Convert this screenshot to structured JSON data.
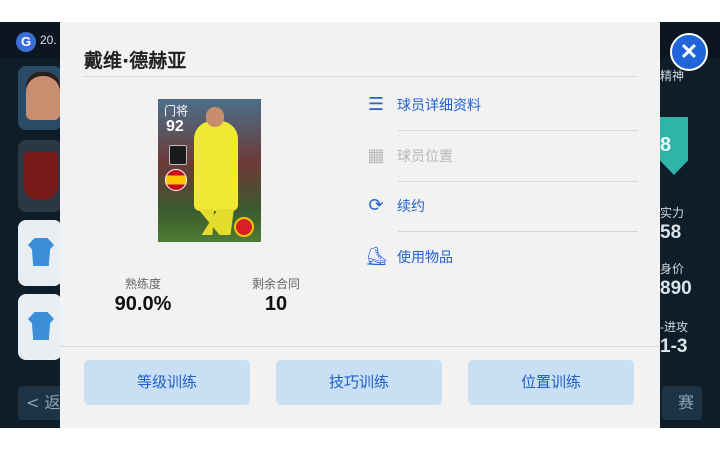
{
  "background": {
    "top_left_text": "20.",
    "nav_left_text": "< 返",
    "nav_right_text": "赛 >",
    "right_stats": [
      {
        "label": "精神",
        "value": "8"
      },
      {
        "label": "实力",
        "value": "58"
      },
      {
        "label": "身价",
        "value": "890"
      },
      {
        "label": "-进攻",
        "value": "1-3"
      }
    ]
  },
  "dialog": {
    "title": "戴维·德赫亚",
    "close_glyph": "✕"
  },
  "card": {
    "position": "门将",
    "overall": "92",
    "nationality_flag": "spain-flag",
    "club_logo": "manchester-united-crest"
  },
  "stats": [
    {
      "label": "熟练度",
      "value": "90.0%"
    },
    {
      "label": "剩余合同",
      "value": "10"
    }
  ],
  "menu": [
    {
      "label": "球员详细资料",
      "icon": "list-icon",
      "glyph": "☰",
      "enabled": true
    },
    {
      "label": "球员位置",
      "icon": "pitch-icon",
      "glyph": "▦",
      "enabled": false
    },
    {
      "label": "续约",
      "icon": "refresh-icon",
      "glyph": "⟳",
      "enabled": true
    },
    {
      "label": "使用物品",
      "icon": "boot-icon",
      "glyph": "⛸",
      "enabled": true
    }
  ],
  "actions": [
    {
      "label": "等级训练"
    },
    {
      "label": "技巧训练"
    },
    {
      "label": "位置训练"
    }
  ],
  "colors": {
    "accent": "#2362d0",
    "button_bg": "#c9dff4",
    "dialog_bg": "#f2f2f2",
    "disabled": "#b8b8b8"
  }
}
